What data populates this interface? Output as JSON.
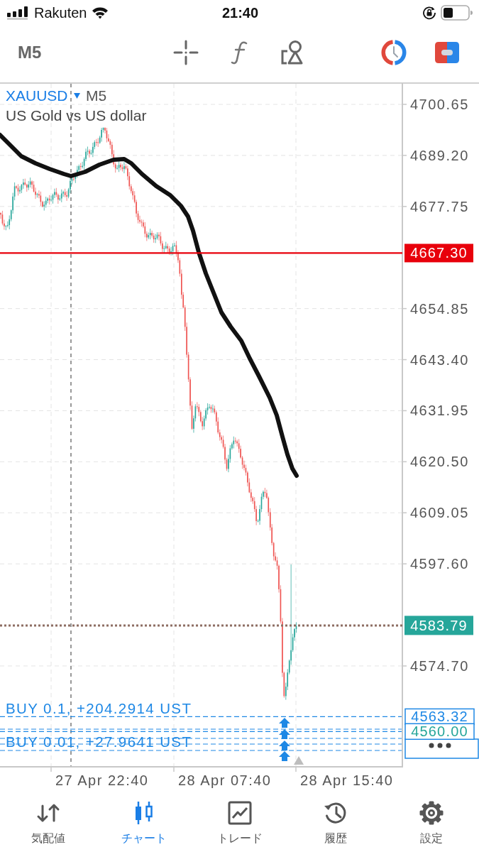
{
  "status_bar": {
    "carrier": "Rakuten",
    "time": "21:40"
  },
  "toolbar": {
    "timeframe": "M5"
  },
  "chart": {
    "symbol": "XAUUSD",
    "timeframe": "M5",
    "description": "US Gold vs US dollar",
    "price_axis": [
      "4700.65",
      "4689.20",
      "4677.75",
      "4654.85",
      "4643.40",
      "4631.95",
      "4620.50",
      "4609.05",
      "4597.60",
      "4574.70"
    ],
    "price_tags": [
      {
        "kind": "level",
        "price": "4667.30",
        "color": "#e8000b"
      },
      {
        "kind": "bid",
        "price": "4583.79",
        "color": "#26a69a"
      },
      {
        "kind": "order",
        "price": "4563.32",
        "color": "#1e88e5"
      },
      {
        "kind": "order",
        "price": "4560.00",
        "color": "#26a69a"
      }
    ],
    "positions": [
      "BUY 0.1, +204.2914 UST",
      "BUY 0.01, +27.9641 UST"
    ],
    "time_axis": [
      "27 Apr 22:40",
      "28 Apr 07:40",
      "28 Apr 15:40"
    ]
  },
  "tabs": [
    {
      "kind": "quotes",
      "label": "気配値",
      "selected": false
    },
    {
      "kind": "chart",
      "label": "チャート",
      "selected": true
    },
    {
      "kind": "trade",
      "label": "トレード",
      "selected": false
    },
    {
      "kind": "history",
      "label": "履歴",
      "selected": false
    },
    {
      "kind": "settings",
      "label": "設定",
      "selected": false
    }
  ]
}
